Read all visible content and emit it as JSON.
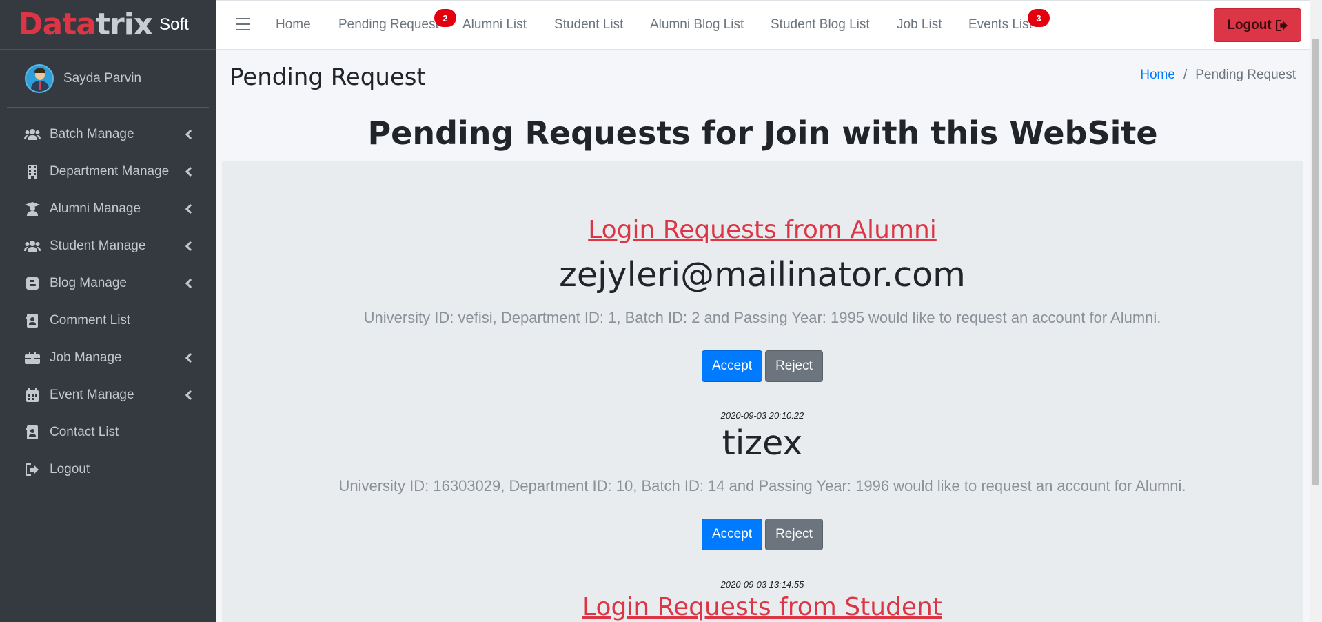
{
  "brand": {
    "logo_first": "D",
    "logo_mid": "ata",
    "logo_end": "trix",
    "suffix": "Soft"
  },
  "user": {
    "name": "Sayda Parvin"
  },
  "sidebar": {
    "items": [
      {
        "label": "Batch Manage",
        "icon": "users-icon",
        "has_chevron": true
      },
      {
        "label": "Department Manage",
        "icon": "building-icon",
        "has_chevron": true
      },
      {
        "label": "Alumni Manage",
        "icon": "graduate-icon",
        "has_chevron": true
      },
      {
        "label": "Student Manage",
        "icon": "users-icon",
        "has_chevron": true
      },
      {
        "label": "Blog Manage",
        "icon": "blog-icon",
        "has_chevron": true
      },
      {
        "label": "Comment List",
        "icon": "contact-card-icon",
        "has_chevron": false
      },
      {
        "label": "Job Manage",
        "icon": "briefcase-icon",
        "has_chevron": true
      },
      {
        "label": "Event Manage",
        "icon": "calendar-icon",
        "has_chevron": true
      },
      {
        "label": "Contact List",
        "icon": "contact-card-icon",
        "has_chevron": false
      },
      {
        "label": "Logout",
        "icon": "sign-out-icon",
        "has_chevron": false
      }
    ]
  },
  "topnav": {
    "items": [
      {
        "label": "Home"
      },
      {
        "label": "Pending Request",
        "badge": "2"
      },
      {
        "label": "Alumni List"
      },
      {
        "label": "Student List"
      },
      {
        "label": "Alumni Blog List"
      },
      {
        "label": "Student Blog List"
      },
      {
        "label": "Job List"
      },
      {
        "label": "Events List",
        "badge": "3"
      }
    ],
    "logout_label": "Logout"
  },
  "page": {
    "title": "Pending Request",
    "breadcrumb": {
      "home": "Home",
      "sep": "/",
      "current": "Pending Request"
    },
    "heading": "Pending Requests for Join with this WebSite"
  },
  "alumni_section": {
    "title": "Login Requests from Alumni",
    "requests": [
      {
        "email": "zejyleri@mailinator.com",
        "description": "University ID: vefisi, Department ID: 1, Batch ID: 2 and Passing Year: 1995 would like to request an account for Alumni.",
        "accept_label": "Accept",
        "reject_label": "Reject",
        "timestamp": "2020-09-03 20:10:22"
      },
      {
        "email": "tizex",
        "description": "University ID: 16303029, Department ID: 10, Batch ID: 14 and Passing Year: 1996 would like to request an account for Alumni.",
        "accept_label": "Accept",
        "reject_label": "Reject",
        "timestamp": "2020-09-03 13:14:55"
      }
    ]
  },
  "student_section": {
    "title": "Login Requests from Student"
  },
  "colors": {
    "sidebar_bg": "#343a40",
    "danger": "#dc3545",
    "primary": "#007bff",
    "secondary": "#6c757d",
    "badge": "#e2000f"
  }
}
